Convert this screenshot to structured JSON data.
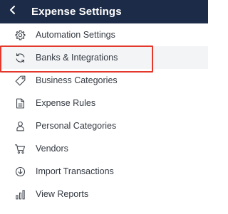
{
  "header": {
    "title": "Expense Settings",
    "back_icon": "chevron-left-icon",
    "background": "#1c2b47"
  },
  "menu": {
    "items": [
      {
        "label": "Automation Settings",
        "icon": "gear-icon"
      },
      {
        "label": "Banks & Integrations",
        "icon": "refresh-icon",
        "highlighted": true
      },
      {
        "label": "Business Categories",
        "icon": "tag-icon"
      },
      {
        "label": "Expense Rules",
        "icon": "document-icon"
      },
      {
        "label": "Personal Categories",
        "icon": "person-icon"
      },
      {
        "label": "Vendors",
        "icon": "cart-icon"
      },
      {
        "label": "Import Transactions",
        "icon": "download-circle-icon"
      },
      {
        "label": "View Reports",
        "icon": "bar-chart-icon"
      }
    ]
  },
  "colors": {
    "highlight_border": "#e3382b",
    "active_row": "#f3f4f6",
    "text": "#343a42"
  }
}
